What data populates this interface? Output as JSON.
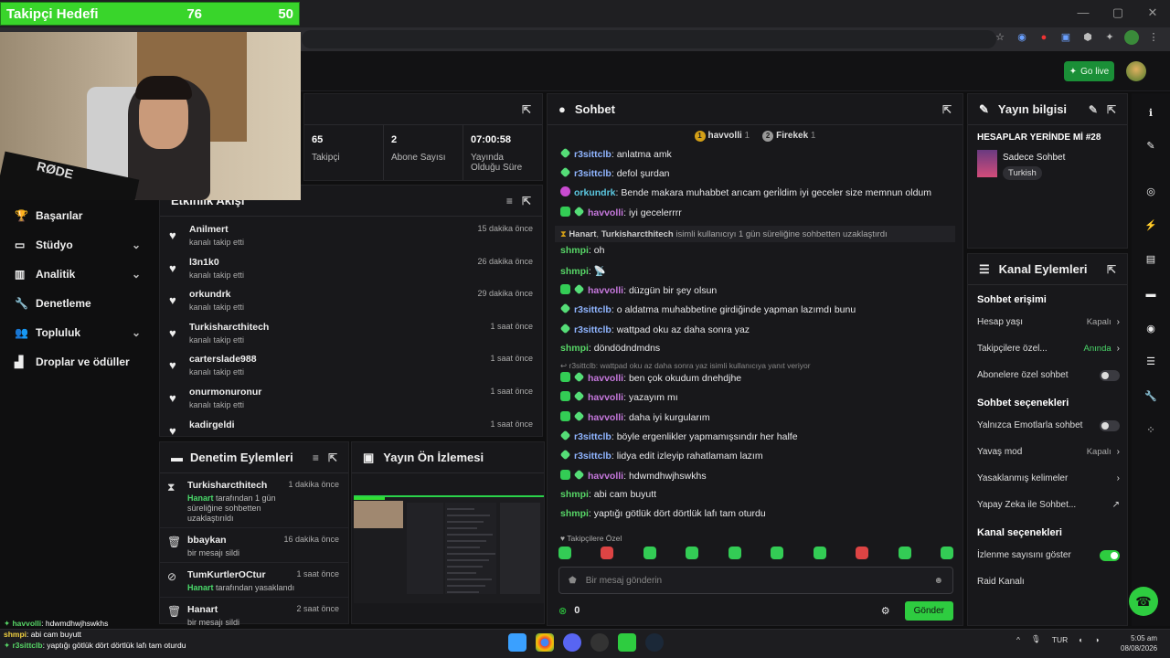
{
  "goal": {
    "label": "Takipçi Hedefi",
    "current": "76",
    "target": "50"
  },
  "header": {
    "go_live": "Go live"
  },
  "sidebar": {
    "items": [
      {
        "label": "Başarılar",
        "icon": "trophy-icon",
        "chevron": false
      },
      {
        "label": "Stüdyo",
        "icon": "studio-icon",
        "chevron": true
      },
      {
        "label": "Analitik",
        "icon": "analytics-icon",
        "chevron": true
      },
      {
        "label": "Denetleme",
        "icon": "wrench-icon",
        "chevron": false
      },
      {
        "label": "Topluluk",
        "icon": "community-icon",
        "chevron": true
      },
      {
        "label": "Droplar ve ödüller",
        "icon": "drops-icon",
        "chevron": false
      }
    ]
  },
  "stats": [
    {
      "value": "65",
      "label": "Takipçi"
    },
    {
      "value": "2",
      "label": "Abone Sayısı"
    },
    {
      "value": "07:00:58",
      "label": "Yayında Olduğu Süre"
    }
  ],
  "activity": {
    "title": "Etkinlik Akışı",
    "items": [
      {
        "name": "Anilmert",
        "sub": "kanalı takip etti",
        "time": "15 dakika önce"
      },
      {
        "name": "l3n1k0",
        "sub": "kanalı takip etti",
        "time": "26 dakika önce"
      },
      {
        "name": "orkundrk",
        "sub": "kanalı takip etti",
        "time": "29 dakika önce"
      },
      {
        "name": "Turkisharcthitech",
        "sub": "kanalı takip etti",
        "time": "1 saat önce"
      },
      {
        "name": "carterslade988",
        "sub": "kanalı takip etti",
        "time": "1 saat önce"
      },
      {
        "name": "onurmonuronur",
        "sub": "kanalı takip etti",
        "time": "1 saat önce"
      },
      {
        "name": "kadirgeldi",
        "sub": "",
        "time": "1 saat önce"
      }
    ]
  },
  "moderation": {
    "title": "Denetim Eylemleri",
    "items": [
      {
        "icon": "hourglass-icon",
        "name": "Turkisharcthitech",
        "by": "Hanart",
        "sub": " tarafından 1 gün süreliğine sohbetten uzaklaştırıldı",
        "time": "1 dakika önce"
      },
      {
        "icon": "trash-icon",
        "name": "bbaykan",
        "by": "",
        "sub": "bir mesajı sildi",
        "time": "16 dakika önce"
      },
      {
        "icon": "ban-icon",
        "name": "TumKurtlerOCtur",
        "by": "Hanart",
        "sub": " tarafından yasaklandı",
        "time": "1 saat önce"
      },
      {
        "icon": "trash-icon",
        "name": "Hanart",
        "by": "",
        "sub": "bir mesajı sildi",
        "time": "2 saat önce"
      }
    ]
  },
  "preview": {
    "title": "Yayın Ön İzlemesi"
  },
  "chat": {
    "title": "Sohbet",
    "leaders": [
      {
        "rank": "1",
        "name": "havvolli",
        "count": "1"
      },
      {
        "rank": "2",
        "name": "Firekek",
        "count": "1"
      }
    ],
    "messages": [
      {
        "user": "r3sittclb",
        "color": "blu",
        "badges": [
          "bs"
        ],
        "text": "anlatma amk"
      },
      {
        "user": "r3sittclb",
        "color": "blu",
        "badges": [
          "bs"
        ],
        "text": "defol şurdan"
      },
      {
        "user": "orkundrk",
        "color": "cy",
        "badges": [
          "bp"
        ],
        "text": "Bende makara muhabbet arıcam geri̇ldim iyi geceler size memnun oldum"
      },
      {
        "user": "havvolli",
        "color": "pur",
        "badges": [
          "bg",
          "bs"
        ],
        "text": "iyi gecelerrrr"
      },
      {
        "system": true,
        "name": "Hanart",
        "name2": "Turkisharcthitech",
        "text": " isimli kullanıcıyı 1 gün süreliğine sohbetten uzaklaştırdı"
      },
      {
        "user": "shmpi",
        "color": "grn",
        "badges": [],
        "text": "oh"
      },
      {
        "user": "shmpi",
        "color": "grn",
        "badges": [],
        "text": "📡"
      },
      {
        "user": "havvolli",
        "color": "pur",
        "badges": [
          "bg",
          "bs"
        ],
        "text": "düzgün bir şey olsun"
      },
      {
        "user": "r3sittclb",
        "color": "blu",
        "badges": [
          "bs"
        ],
        "text": "o aldatma muhabbetine girdiğinde yapman lazımdı bunu"
      },
      {
        "user": "r3sittclb",
        "color": "blu",
        "badges": [
          "bs"
        ],
        "text": "wattpad oku az daha sonra yaz"
      },
      {
        "user": "shmpi",
        "color": "grn",
        "badges": [],
        "text": "döndödndmdns"
      },
      {
        "reply": "r3sittclb: wattpad oku az daha sonra yaz isimli kullanıcıya yanıt veriyor"
      },
      {
        "user": "havvolli",
        "color": "pur",
        "badges": [
          "bg",
          "bs"
        ],
        "text": "ben çok okudum dnehdjhe"
      },
      {
        "user": "havvolli",
        "color": "pur",
        "badges": [
          "bg",
          "bs"
        ],
        "text": "yazayım mı"
      },
      {
        "user": "havvolli",
        "color": "pur",
        "badges": [
          "bg",
          "bs"
        ],
        "text": "daha iyi kurgularım"
      },
      {
        "user": "r3sittclb",
        "color": "blu",
        "badges": [
          "bs"
        ],
        "text": "böyle ergenlikler yapmamışsındır her halfe"
      },
      {
        "user": "r3sittclb",
        "color": "blu",
        "badges": [
          "bs"
        ],
        "text": "lidya edit izleyip rahatlamam lazım"
      },
      {
        "user": "havvolli",
        "color": "pur",
        "badges": [
          "bg",
          "bs"
        ],
        "text": "hdwmdhwjhswkhs"
      },
      {
        "user": "shmpi",
        "color": "grn",
        "badges": [],
        "text": "abi cam buyutt"
      },
      {
        "user": "shmpi",
        "color": "grn",
        "badges": [],
        "text": "yaptığı götlük dört dörtlük lafı tam oturdu"
      }
    ],
    "emote_label": "Takipçilere Özel",
    "input_placeholder": "Bir mesaj gönderin",
    "points": "0",
    "send": "Gönder"
  },
  "info": {
    "title": "Yayın bilgisi",
    "stream_title": "HESAPLAR YERİNDE Mİ #28",
    "category": "Sadece Sohbet",
    "tag": "Turkish"
  },
  "channel": {
    "title": "Kanal Eylemleri",
    "chat_access": "Sohbet erişimi",
    "account_age": {
      "label": "Hesap yaşı",
      "value": "Kapalı"
    },
    "followers_only": {
      "label": "Takipçilere özel...",
      "value": "Anında"
    },
    "subs_only": {
      "label": "Abonelere özel sohbet"
    },
    "chat_options": "Sohbet seçenekleri",
    "emote_only": {
      "label": "Yalnızca Emotlarla sohbet"
    },
    "slow_mode": {
      "label": "Yavaş mod",
      "value": "Kapalı"
    },
    "banned_words": {
      "label": "Yasaklanmış kelimeler"
    },
    "ai_chat": {
      "label": "Yapay Zeka ile Sohbet..."
    },
    "channel_options": "Kanal seçenekleri",
    "show_viewers": {
      "label": "İzlenme sayısını göster"
    },
    "raid": {
      "label": "Raid Kanalı"
    }
  },
  "overlay_chat": [
    {
      "user": "havvolli",
      "text": ": hdwmdhwjhswkhs"
    },
    {
      "user": "shmpi",
      "text": ": abi cam buyutt"
    },
    {
      "user": "r3sittclb",
      "text": ": yaptığı götlük dört dörtlük lafı tam oturdu"
    }
  ],
  "taskbar": {
    "lang": "TUR",
    "time": "5:05 am",
    "date": "08/08/2026"
  }
}
